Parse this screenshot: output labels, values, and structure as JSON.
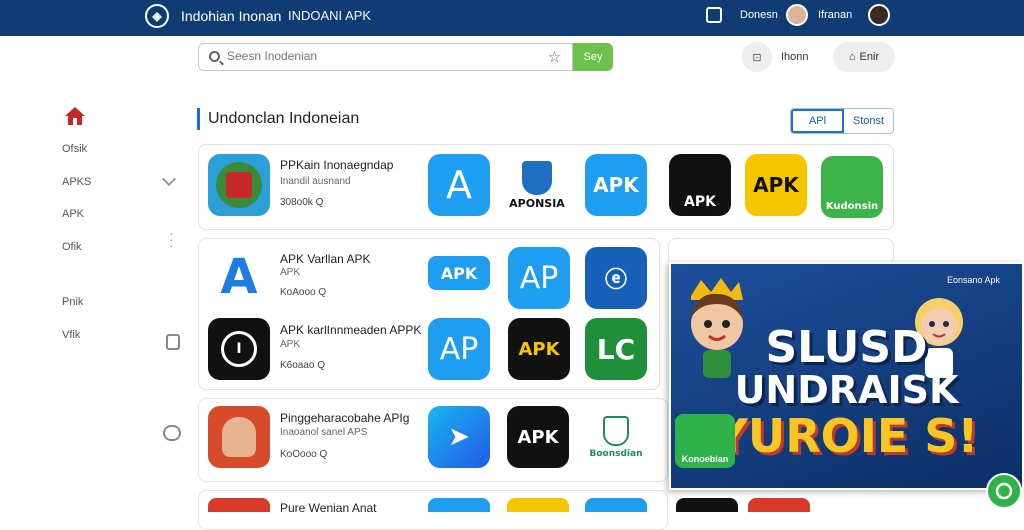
{
  "header": {
    "app_title": "Indohian Inonan",
    "app_subtitle": "INDOANI APK",
    "user1": "Donesn",
    "user2": "Ifranan"
  },
  "search": {
    "placeholder": "Seesn Inodenian",
    "go_label": "Sey",
    "circle_label": "Ihonn",
    "pill_label": "Enir"
  },
  "sidebar": {
    "items": [
      "Ofsik",
      "APKS",
      "APK",
      "Ofik",
      "Pnik",
      "Vfik"
    ]
  },
  "main": {
    "section_title": "Undonclan Indoneian",
    "segments": [
      "APl",
      "Stonst"
    ],
    "rows": [
      {
        "name": "PPKain Inonaegndap",
        "sub": "Inandil ausnand",
        "size": "308o0k Q"
      },
      {
        "name": "APK Varllan APK",
        "sub": "APK",
        "size": "KoAooo Q"
      },
      {
        "name": "APK karlInnmeaden APPK",
        "sub": "APK",
        "size": "K6oaao Q"
      },
      {
        "name": "Pinggeharacobahe APIg",
        "sub": "Inaoanol sanel APS",
        "size": "KoOooo Q"
      },
      {
        "name": "Pure Wenian Anat",
        "sub": "",
        "size": ""
      }
    ],
    "tile_labels": [
      "APONSIA",
      "APK",
      "APK",
      "APK",
      "Kudonsin",
      "APK",
      "AP",
      "APK",
      "AP",
      "APK",
      "LC",
      "APK",
      "Boonsdian"
    ]
  },
  "banner": {
    "line1": "SLUSD",
    "line2": "UNDRAISK",
    "line3": "YUROIE S!",
    "badge": "Eonsano Apk",
    "logo_text": "Konoebian"
  }
}
